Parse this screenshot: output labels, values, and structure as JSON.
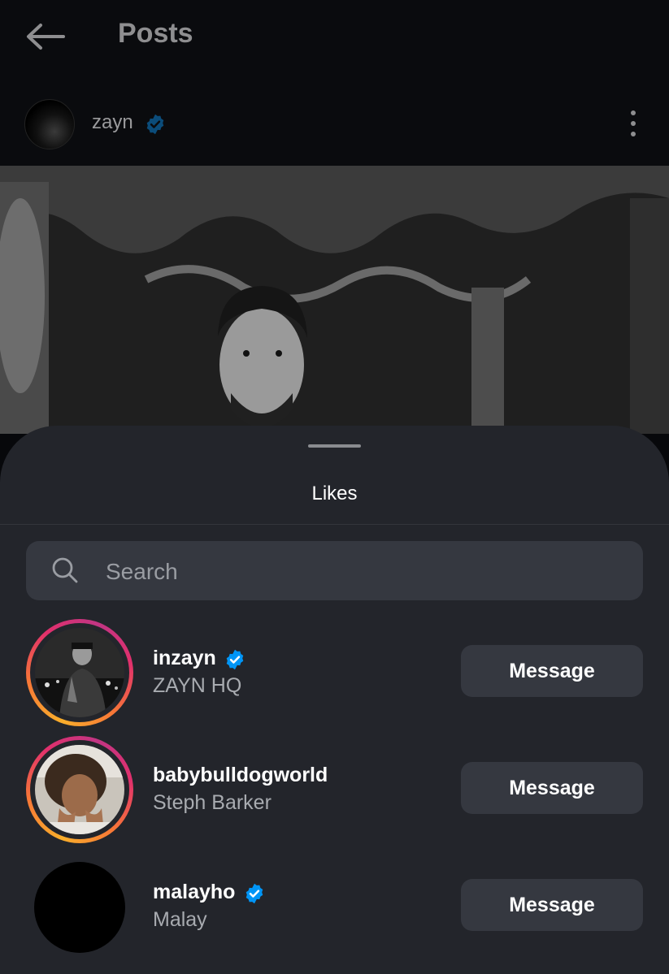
{
  "header": {
    "title": "Posts",
    "back_icon": "arrow-left-icon"
  },
  "post": {
    "username": "zayn",
    "verified": true,
    "more_icon": "more-vertical-icon"
  },
  "likes_sheet": {
    "title": "Likes",
    "search": {
      "placeholder": "Search",
      "value": ""
    },
    "users": [
      {
        "username": "inzayn",
        "full_name": "ZAYN HQ",
        "verified": true,
        "has_story": true,
        "button_label": "Message"
      },
      {
        "username": "babybulldogworld",
        "full_name": "Steph Barker",
        "verified": false,
        "has_story": true,
        "button_label": "Message"
      },
      {
        "username": "malayho",
        "full_name": "Malay",
        "verified": true,
        "has_story": false,
        "button_label": "Message"
      }
    ]
  },
  "colors": {
    "verified_badge": "#0095f6",
    "sheet_bg": "#23252b",
    "button_bg": "#353840"
  }
}
